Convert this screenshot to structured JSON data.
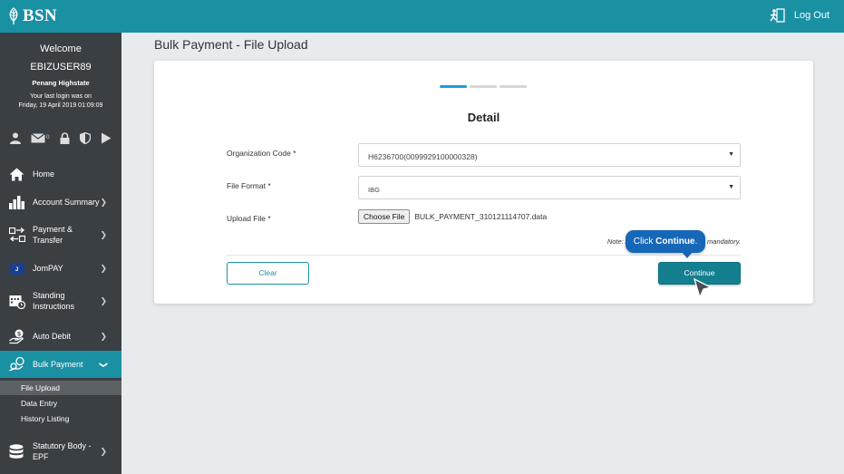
{
  "header": {
    "logo_text": "BSN",
    "logout_label": "Log Out"
  },
  "sidebar": {
    "welcome": "Welcome",
    "username": "EBIZUSER89",
    "branch": "Penang Highstate",
    "last_login_line1": "Your last login was on",
    "last_login_line2": "Friday, 19 April 2019 01:09:09",
    "mail_count": "0",
    "quick_icons": [
      "user-icon",
      "mail-icon",
      "lock-icon",
      "shield-icon",
      "play-icon"
    ],
    "menu": [
      {
        "label": "Home",
        "icon": "home-icon"
      },
      {
        "label": "Account Summary",
        "icon": "bar-chart-icon"
      },
      {
        "label": "Payment &\nTransfer",
        "icon": "transfer-icon"
      },
      {
        "label": "JomPAY",
        "icon": "jompay-icon"
      },
      {
        "label": "Standing\nInstructions",
        "icon": "calendar-icon"
      },
      {
        "label": "Auto Debit",
        "icon": "hand-coin-icon"
      },
      {
        "label": "Bulk Payment",
        "icon": "coins-icon"
      },
      {
        "label": "Statutory Body -\nEPF",
        "icon": "database-icon"
      }
    ],
    "submenu": [
      "File Upload",
      "Data Entry",
      "History Listing"
    ]
  },
  "page": {
    "title": "Bulk Payment - File Upload",
    "steps_total": 3,
    "steps_current": 1,
    "section_title": "Detail"
  },
  "form": {
    "org_code_label": "Organization Code *",
    "org_code_value": "H6236700(0099929100000328)",
    "file_format_label": "File Format *",
    "file_format_value": "IBG",
    "upload_label": "Upload File *",
    "choose_file_label": "Choose File",
    "file_name": "BULK_PAYMENT_310121114707.data",
    "note": "Note: All fields marked with * are mandatory.",
    "clear_label": "Clear",
    "continue_label": "Continue"
  },
  "tooltip": {
    "prefix": "Click ",
    "action": "Continue",
    "suffix": "."
  },
  "colors": {
    "brand": "#1a90a3",
    "sidebar": "#3a3f44",
    "tooltip": "#1667b7",
    "progress_active": "#1a9fd6"
  }
}
